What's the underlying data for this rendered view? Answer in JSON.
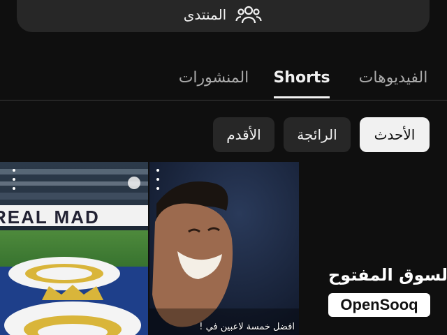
{
  "community": {
    "label": "المنتدى",
    "icon": "people-group-icon"
  },
  "tabs": [
    {
      "label": "الفيديوهات"
    },
    {
      "label": "Shorts",
      "active": true
    },
    {
      "label": "المنشورات"
    }
  ],
  "chips": [
    {
      "label": "الأحدث",
      "selected": true
    },
    {
      "label": "الرائجة"
    },
    {
      "label": "الأقدم"
    }
  ],
  "shorts": [
    {
      "caption": "",
      "menu_icon": "more-vert-icon"
    },
    {
      "caption": "افضل خمسة لاعبين في !",
      "menu_icon": "more-vert-icon"
    }
  ],
  "watermark": {
    "arabic": "السوق المفتوح",
    "brand": "OpenSooq"
  }
}
